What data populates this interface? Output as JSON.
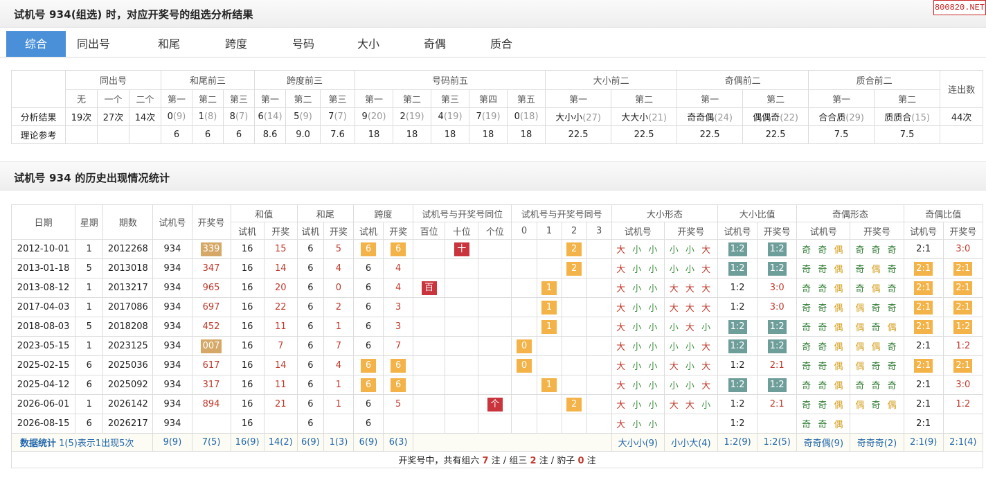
{
  "header1": {
    "title": "试机号 934(组选) 时，对应开奖号的组选分析结果"
  },
  "logo": "800820.NET",
  "tabs": [
    {
      "label": "综合",
      "active": true
    },
    {
      "label": "同出号"
    },
    {
      "label": "和尾"
    },
    {
      "label": "跨度"
    },
    {
      "label": "号码"
    },
    {
      "label": "大小"
    },
    {
      "label": "奇偶"
    },
    {
      "label": "质合"
    }
  ],
  "summary": {
    "groups": [
      "同出号",
      "和尾前三",
      "跨度前三",
      "号码前五",
      "大小前二",
      "奇偶前二",
      "质合前二",
      "连出数"
    ],
    "subs": {
      "tongchu": [
        "无",
        "一个",
        "二个"
      ],
      "ord": [
        "第一",
        "第二",
        "第三",
        "第四",
        "第五"
      ]
    },
    "row_labels": [
      "分析结果",
      "理论参考"
    ],
    "result": {
      "tongchu": [
        "19次",
        "27次",
        "14次"
      ],
      "hewei": [
        [
          "0",
          "(9)"
        ],
        [
          "1",
          "(8)"
        ],
        [
          "8",
          "(7)"
        ]
      ],
      "kuadu": [
        [
          "6",
          "(14)"
        ],
        [
          "5",
          "(9)"
        ],
        [
          "7",
          "(7)"
        ]
      ],
      "haoma": [
        [
          "9",
          "(20)"
        ],
        [
          "2",
          "(19)"
        ],
        [
          "4",
          "(19)"
        ],
        [
          "7",
          "(19)"
        ],
        [
          "0",
          "(18)"
        ]
      ],
      "daxiao": [
        [
          "大小小",
          "(27)"
        ],
        [
          "大大小",
          "(21)"
        ]
      ],
      "jiou": [
        [
          "奇奇偶",
          "(24)"
        ],
        [
          "偶偶奇",
          "(22)"
        ]
      ],
      "zhihe": [
        [
          "合合质",
          "(29)"
        ],
        [
          "质质合",
          "(15)"
        ]
      ],
      "lianchu": "44次"
    },
    "ref": {
      "hewei": [
        "6",
        "6",
        "6"
      ],
      "kuadu": [
        "8.6",
        "9.0",
        "7.6"
      ],
      "haoma": [
        "18",
        "18",
        "18",
        "18",
        "18"
      ],
      "daxiao": [
        "22.5",
        "22.5"
      ],
      "jiou": [
        "22.5",
        "22.5"
      ],
      "zhihe": [
        "7.5",
        "7.5"
      ]
    }
  },
  "header2": {
    "title": "试机号 934 的历史出现情况统计"
  },
  "history": {
    "head": {
      "date": "日期",
      "week": "星期",
      "issue": "期数",
      "sjh": "试机号",
      "kjh": "开奖号",
      "hezhi": "和值",
      "hewei": "和尾",
      "kuadu": "跨度",
      "tongwei": "试机号与开奖号同位",
      "tonghao": "试机号与开奖号同号",
      "dxxt": "大小形态",
      "dxbz": "大小比值",
      "joxt": "奇偶形态",
      "jobz": "奇偶比值",
      "sj": "试机",
      "kj": "开奖",
      "sjh2": "试机号",
      "kjh2": "开奖号",
      "pos": [
        "百位",
        "十位",
        "个位"
      ],
      "num": [
        "0",
        "1",
        "2",
        "3"
      ]
    },
    "rows": [
      {
        "date": "2012-10-01",
        "week": "1",
        "issue": "2012268",
        "sjh": "934",
        "kjh": "339",
        "kjh_box": "tan",
        "hz_s": "16",
        "hz_k": "15",
        "hw_s": "6",
        "hw_k": "5",
        "kd_s": "6",
        "kd_k": "6",
        "kd_box": true,
        "pos": [
          "",
          "十",
          ""
        ],
        "num": [
          "",
          "",
          "2",
          ""
        ],
        "dx_s": [
          "大",
          "小",
          "小"
        ],
        "dx_k": [
          "小",
          "小",
          "大"
        ],
        "dxb_s": "1:2",
        "dxb_k": "1:2",
        "dxb_sbox": true,
        "dxb_kbox": true,
        "jo_s": [
          "奇",
          "奇",
          "偶"
        ],
        "jo_k": [
          "奇",
          "奇",
          "奇"
        ],
        "job_s": "2:1",
        "job_k": "3:0",
        "job_sbox": false,
        "job_kbox": false
      },
      {
        "date": "2013-01-18",
        "week": "5",
        "issue": "2013018",
        "sjh": "934",
        "kjh": "347",
        "kjh_box": "",
        "hz_s": "16",
        "hz_k": "14",
        "hw_s": "6",
        "hw_k": "4",
        "kd_s": "6",
        "kd_k": "4",
        "kd_box": false,
        "pos": [
          "",
          "",
          ""
        ],
        "num": [
          "",
          "",
          "2",
          ""
        ],
        "dx_s": [
          "大",
          "小",
          "小"
        ],
        "dx_k": [
          "小",
          "小",
          "大"
        ],
        "dxb_s": "1:2",
        "dxb_k": "1:2",
        "dxb_sbox": true,
        "dxb_kbox": true,
        "jo_s": [
          "奇",
          "奇",
          "偶"
        ],
        "jo_k": [
          "奇",
          "偶",
          "奇"
        ],
        "job_s": "2:1",
        "job_k": "2:1",
        "job_sbox": true,
        "job_kbox": true
      },
      {
        "date": "2013-08-12",
        "week": "1",
        "issue": "2013217",
        "sjh": "934",
        "kjh": "965",
        "kjh_box": "",
        "hz_s": "16",
        "hz_k": "20",
        "hw_s": "6",
        "hw_k": "0",
        "kd_s": "6",
        "kd_k": "4",
        "kd_box": false,
        "pos": [
          "百",
          "",
          ""
        ],
        "num": [
          "",
          "1",
          "",
          ""
        ],
        "dx_s": [
          "大",
          "小",
          "小"
        ],
        "dx_k": [
          "大",
          "大",
          "大"
        ],
        "dxb_s": "1:2",
        "dxb_k": "3:0",
        "dxb_sbox": false,
        "dxb_kbox": false,
        "jo_s": [
          "奇",
          "奇",
          "偶"
        ],
        "jo_k": [
          "奇",
          "偶",
          "奇"
        ],
        "job_s": "2:1",
        "job_k": "2:1",
        "job_sbox": true,
        "job_kbox": true
      },
      {
        "date": "2017-04-03",
        "week": "1",
        "issue": "2017086",
        "sjh": "934",
        "kjh": "697",
        "kjh_box": "",
        "hz_s": "16",
        "hz_k": "22",
        "hw_s": "6",
        "hw_k": "2",
        "kd_s": "6",
        "kd_k": "3",
        "kd_box": false,
        "pos": [
          "",
          "",
          ""
        ],
        "num": [
          "",
          "1",
          "",
          ""
        ],
        "dx_s": [
          "大",
          "小",
          "小"
        ],
        "dx_k": [
          "大",
          "大",
          "大"
        ],
        "dxb_s": "1:2",
        "dxb_k": "3:0",
        "dxb_sbox": false,
        "dxb_kbox": false,
        "jo_s": [
          "奇",
          "奇",
          "偶"
        ],
        "jo_k": [
          "偶",
          "奇",
          "奇"
        ],
        "job_s": "2:1",
        "job_k": "2:1",
        "job_sbox": true,
        "job_kbox": true
      },
      {
        "date": "2018-08-03",
        "week": "5",
        "issue": "2018208",
        "sjh": "934",
        "kjh": "452",
        "kjh_box": "",
        "hz_s": "16",
        "hz_k": "11",
        "hw_s": "6",
        "hw_k": "1",
        "kd_s": "6",
        "kd_k": "3",
        "kd_box": false,
        "pos": [
          "",
          "",
          ""
        ],
        "num": [
          "",
          "1",
          "",
          ""
        ],
        "dx_s": [
          "大",
          "小",
          "小"
        ],
        "dx_k": [
          "小",
          "大",
          "小"
        ],
        "dxb_s": "1:2",
        "dxb_k": "1:2",
        "dxb_sbox": true,
        "dxb_kbox": true,
        "jo_s": [
          "奇",
          "奇",
          "偶"
        ],
        "jo_k": [
          "偶",
          "奇",
          "偶"
        ],
        "job_s": "2:1",
        "job_k": "1:2",
        "job_sbox": true,
        "job_kbox": true
      },
      {
        "date": "2023-05-15",
        "week": "1",
        "issue": "2023125",
        "sjh": "934",
        "kjh": "007",
        "kjh_box": "tan",
        "hz_s": "16",
        "hz_k": "7",
        "hw_s": "6",
        "hw_k": "7",
        "kd_s": "6",
        "kd_k": "7",
        "kd_box": false,
        "pos": [
          "",
          "",
          ""
        ],
        "num": [
          "0",
          "",
          "",
          ""
        ],
        "dx_s": [
          "大",
          "小",
          "小"
        ],
        "dx_k": [
          "小",
          "小",
          "大"
        ],
        "dxb_s": "1:2",
        "dxb_k": "1:2",
        "dxb_sbox": true,
        "dxb_kbox": true,
        "jo_s": [
          "奇",
          "奇",
          "偶"
        ],
        "jo_k": [
          "偶",
          "偶",
          "奇"
        ],
        "job_s": "2:1",
        "job_k": "1:2",
        "job_sbox": false,
        "job_kbox": false
      },
      {
        "date": "2025-02-15",
        "week": "6",
        "issue": "2025036",
        "sjh": "934",
        "kjh": "617",
        "kjh_box": "",
        "hz_s": "16",
        "hz_k": "14",
        "hw_s": "6",
        "hw_k": "4",
        "kd_s": "6",
        "kd_k": "6",
        "kd_box": true,
        "pos": [
          "",
          "",
          ""
        ],
        "num": [
          "0",
          "",
          "",
          ""
        ],
        "dx_s": [
          "大",
          "小",
          "小"
        ],
        "dx_k": [
          "大",
          "小",
          "大"
        ],
        "dxb_s": "1:2",
        "dxb_k": "2:1",
        "dxb_sbox": false,
        "dxb_kbox": false,
        "jo_s": [
          "奇",
          "奇",
          "偶"
        ],
        "jo_k": [
          "偶",
          "奇",
          "奇"
        ],
        "job_s": "2:1",
        "job_k": "2:1",
        "job_sbox": true,
        "job_kbox": true
      },
      {
        "date": "2025-04-12",
        "week": "6",
        "issue": "2025092",
        "sjh": "934",
        "kjh": "317",
        "kjh_box": "",
        "hz_s": "16",
        "hz_k": "11",
        "hw_s": "6",
        "hw_k": "1",
        "kd_s": "6",
        "kd_k": "6",
        "kd_box": true,
        "pos": [
          "",
          "",
          ""
        ],
        "num": [
          "",
          "1",
          "",
          ""
        ],
        "dx_s": [
          "大",
          "小",
          "小"
        ],
        "dx_k": [
          "小",
          "小",
          "大"
        ],
        "dxb_s": "1:2",
        "dxb_k": "1:2",
        "dxb_sbox": true,
        "dxb_kbox": true,
        "jo_s": [
          "奇",
          "奇",
          "偶"
        ],
        "jo_k": [
          "奇",
          "奇",
          "奇"
        ],
        "job_s": "2:1",
        "job_k": "3:0",
        "job_sbox": false,
        "job_kbox": false
      },
      {
        "date": "2026-06-01",
        "week": "1",
        "issue": "2026142",
        "sjh": "934",
        "kjh": "894",
        "kjh_box": "",
        "hz_s": "16",
        "hz_k": "21",
        "hw_s": "6",
        "hw_k": "1",
        "kd_s": "6",
        "kd_k": "5",
        "kd_box": false,
        "pos": [
          "",
          "",
          "个"
        ],
        "num": [
          "",
          "",
          "2",
          ""
        ],
        "dx_s": [
          "大",
          "小",
          "小"
        ],
        "dx_k": [
          "大",
          "大",
          "小"
        ],
        "dxb_s": "1:2",
        "dxb_k": "2:1",
        "dxb_sbox": false,
        "dxb_kbox": false,
        "jo_s": [
          "奇",
          "奇",
          "偶"
        ],
        "jo_k": [
          "偶",
          "奇",
          "偶"
        ],
        "job_s": "2:1",
        "job_k": "1:2",
        "job_sbox": false,
        "job_kbox": false
      },
      {
        "date": "2026-08-15",
        "week": "6",
        "issue": "2026217",
        "sjh": "934",
        "kjh": "",
        "kjh_box": "",
        "hz_s": "16",
        "hz_k": "",
        "hw_s": "6",
        "hw_k": "",
        "kd_s": "6",
        "kd_k": "",
        "kd_box": false,
        "pos": [
          "",
          "",
          ""
        ],
        "num": [
          "",
          "",
          "",
          ""
        ],
        "dx_s": [
          "大",
          "小",
          "小"
        ],
        "dx_k": [
          "",
          "",
          ""
        ],
        "dxb_s": "1:2",
        "dxb_k": "",
        "dxb_sbox": false,
        "dxb_kbox": false,
        "jo_s": [
          "奇",
          "奇",
          "偶"
        ],
        "jo_k": [
          "",
          "",
          ""
        ],
        "job_s": "2:1",
        "job_k": "",
        "job_sbox": false,
        "job_kbox": false
      }
    ],
    "stats": {
      "label": "数据统计",
      "note": "1(5)表示1出现5次",
      "cells": [
        "9(9)",
        "7(5)",
        "16(9)",
        "14(2)",
        "6(9)",
        "1(3)",
        "6(9)",
        "6(3)",
        "大小小(9)",
        "小小大(4)",
        "1:2(9)",
        "1:2(5)",
        "奇奇偶(9)",
        "奇奇奇(2)",
        "2:1(9)",
        "2:1(4)"
      ]
    },
    "sum": {
      "prefix": "开奖号中，共有组六 ",
      "z6": "7",
      "mid1": " 注 / 组三 ",
      "z3": "2",
      "mid2": " 注 / 豹子 ",
      "bz": "0",
      "suffix": " 注"
    }
  }
}
